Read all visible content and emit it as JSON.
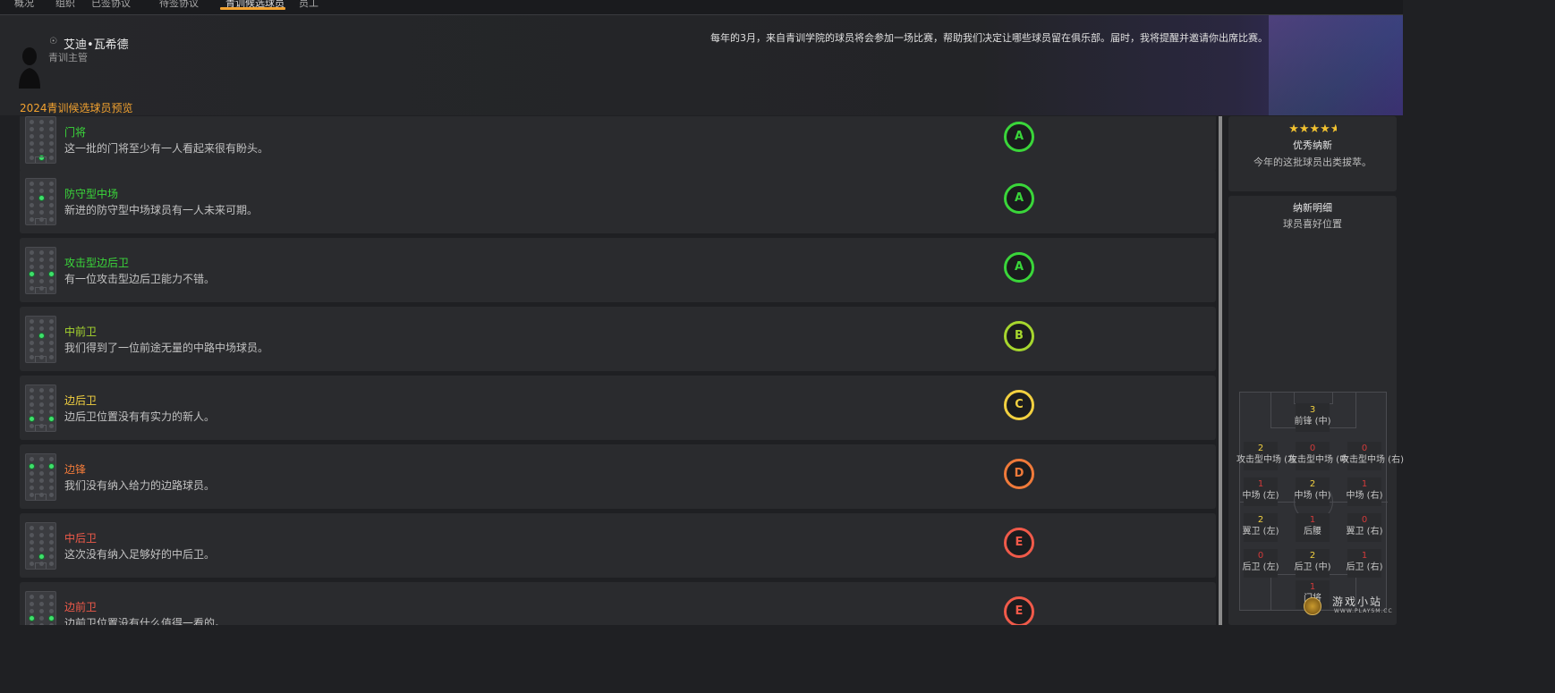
{
  "nav": {
    "tabs": [
      {
        "label": "概况"
      },
      {
        "label": "组织"
      },
      {
        "label": "已签协议"
      },
      {
        "label": "待签协议"
      },
      {
        "label": "青训候选球员"
      },
      {
        "label": "员工"
      }
    ],
    "active_index": 4
  },
  "header": {
    "person_name": "艾迪•瓦希德",
    "person_role": "青训主管",
    "banner": "每年的3月，来自青训学院的球员将会参加一场比赛，帮助我们决定让哪些球员留在俱乐部。届时，我将提醒并邀请你出席比赛。",
    "section_title": "2024青训候选球员预览"
  },
  "rows": [
    {
      "title": "门将",
      "desc": "这一批的门将至少有一人看起来很有盼头。",
      "grade": "A",
      "color": "#3ad63a",
      "dots": [
        16
      ]
    },
    {
      "title": "防守型中场",
      "desc": "新进的防守型中场球员有一人未来可期。",
      "grade": "A",
      "color": "#3ad63a",
      "dots": [
        7
      ]
    },
    {
      "title": "攻击型边后卫",
      "desc": "有一位攻击型边后卫能力不错。",
      "grade": "A",
      "color": "#3ad63a",
      "dots": [
        9,
        11
      ]
    },
    {
      "title": "中前卫",
      "desc": "我们得到了一位前途无量的中路中场球员。",
      "grade": "B",
      "color": "#a6d62e",
      "dots": [
        7
      ]
    },
    {
      "title": "边后卫",
      "desc": "边后卫位置没有有实力的新人。",
      "grade": "C",
      "color": "#f2d040",
      "dots": [
        12,
        14
      ]
    },
    {
      "title": "边锋",
      "desc": "我们没有纳入给力的边路球员。",
      "grade": "D",
      "color": "#f07a3a",
      "dots": [
        3,
        5
      ]
    },
    {
      "title": "中后卫",
      "desc": "这次没有纳入足够好的中后卫。",
      "grade": "E",
      "color": "#f05a4a",
      "dots": [
        13
      ]
    },
    {
      "title": "边前卫",
      "desc": "边前卫位置没有什么值得一看的。",
      "grade": "E",
      "color": "#f05a4a",
      "dots": [
        9,
        11
      ]
    }
  ],
  "summary": {
    "stars": "★★★★★",
    "rating_stars": 4.5,
    "title": "优秀纳新",
    "subtitle": "今年的这批球员出类拔萃。"
  },
  "breakdown": {
    "title": "纳新明细",
    "subtitle": "球员喜好位置",
    "zones": [
      {
        "count": "3",
        "label": "前锋 (中)",
        "color": "#f2d040"
      },
      {
        "count": "2",
        "label": "攻击型中场 (左)",
        "color": "#f2d040"
      },
      {
        "count": "0",
        "label": "攻击型中场 (中)",
        "color": "#d23a3a"
      },
      {
        "count": "0",
        "label": "攻击型中场 (右)",
        "color": "#d23a3a"
      },
      {
        "count": "1",
        "label": "中场 (左)",
        "color": "#d23a3a"
      },
      {
        "count": "2",
        "label": "中场 (中)",
        "color": "#f2d040"
      },
      {
        "count": "1",
        "label": "中场 (右)",
        "color": "#d23a3a"
      },
      {
        "count": "2",
        "label": "翼卫 (左)",
        "color": "#f2d040"
      },
      {
        "count": "1",
        "label": "后腰",
        "color": "#d23a3a"
      },
      {
        "count": "0",
        "label": "翼卫 (右)",
        "color": "#d23a3a"
      },
      {
        "count": "0",
        "label": "后卫 (左)",
        "color": "#d23a3a"
      },
      {
        "count": "2",
        "label": "后卫 (中)",
        "color": "#f2d040"
      },
      {
        "count": "1",
        "label": "后卫 (右)",
        "color": "#d23a3a"
      },
      {
        "count": "1",
        "label": "门将",
        "color": "#d23a3a"
      }
    ]
  },
  "watermark": {
    "text": "游戏小站",
    "url_text": "WWW.PLAYSM.CC"
  }
}
